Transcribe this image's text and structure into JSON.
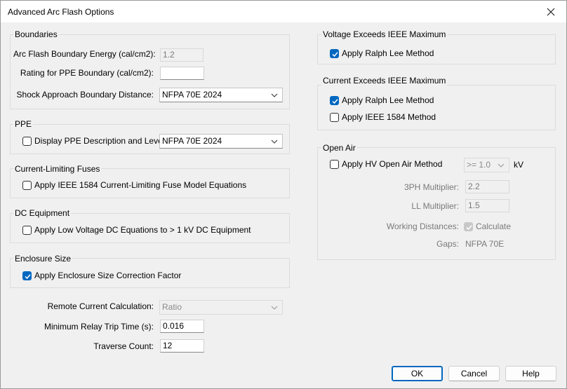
{
  "window": {
    "title": "Advanced Arc Flash Options"
  },
  "colors": {
    "accent": "#0067c0",
    "background": "#f0f0f0",
    "disabled_text": "#7a7a7a"
  },
  "icons": {
    "close": "close-icon",
    "dropdown": "chevron-down-icon",
    "check": "checkmark-icon"
  },
  "boundaries": {
    "title": "Boundaries",
    "energy_label": "Arc Flash Boundary Energy (cal/cm2):",
    "energy_value": "1.2",
    "ppe_rating_label": "Rating for PPE Boundary (cal/cm2):",
    "ppe_rating_value": "",
    "shock_label": "Shock Approach Boundary Distance:",
    "shock_value": "NFPA 70E 2024"
  },
  "ppe": {
    "title": "PPE",
    "display_label": "Display PPE Description and Level",
    "display_checked": false,
    "standard_value": "NFPA 70E 2024"
  },
  "fuses": {
    "title": "Current-Limiting Fuses",
    "apply_label": "Apply IEEE 1584 Current-Limiting Fuse Model Equations",
    "apply_checked": false
  },
  "dc": {
    "title": "DC Equipment",
    "apply_label": "Apply Low Voltage DC Equations to > 1 kV DC Equipment",
    "apply_checked": false
  },
  "enclosure": {
    "title": "Enclosure Size",
    "apply_label": "Apply Enclosure Size Correction Factor",
    "apply_checked": true
  },
  "misc": {
    "remote_label": "Remote Current Calculation:",
    "remote_value": "Ratio",
    "trip_label": "Minimum Relay Trip Time (s):",
    "trip_value": "0.016",
    "traverse_label": "Traverse Count:",
    "traverse_value": "12"
  },
  "voltage": {
    "title": "Voltage Exceeds IEEE Maximum",
    "ralph_label": "Apply Ralph Lee Method",
    "ralph_checked": true
  },
  "current": {
    "title": "Current Exceeds IEEE Maximum",
    "ralph_label": "Apply Ralph Lee Method",
    "ralph_checked": true,
    "ieee_label": "Apply IEEE 1584 Method",
    "ieee_checked": false
  },
  "open_air": {
    "title": "Open Air",
    "hv_label": "Apply HV Open Air Method",
    "hv_checked": false,
    "kv_value": ">= 1.0",
    "kv_unit": "kV",
    "ph3_label": "3PH Multiplier:",
    "ph3_value": "2.2",
    "ll_label": "LL Multiplier:",
    "ll_value": "1.5",
    "wd_label": "Working Distances:",
    "wd_calc_label": "Calculate",
    "wd_calc_checked": true,
    "gaps_label": "Gaps:",
    "gaps_value": "NFPA 70E"
  },
  "buttons": {
    "ok": "OK",
    "cancel": "Cancel",
    "help": "Help"
  }
}
